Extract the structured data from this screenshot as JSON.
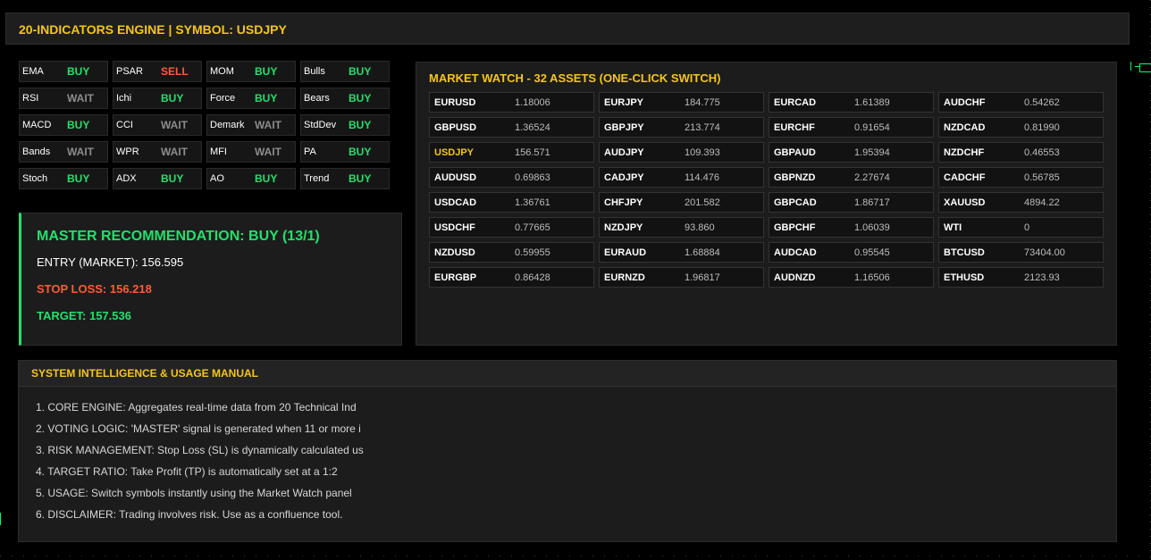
{
  "header": {
    "title": "20-INDICATORS ENGINE | SYMBOL: USDJPY"
  },
  "colors": {
    "buy": "#22e06b",
    "sell": "#ff5a36",
    "wait": "#8c8c8c",
    "accent": "#f5c518"
  },
  "indicators": [
    {
      "name": "EMA",
      "signal": "BUY"
    },
    {
      "name": "PSAR",
      "signal": "SELL"
    },
    {
      "name": "MOM",
      "signal": "BUY"
    },
    {
      "name": "Bulls",
      "signal": "BUY"
    },
    {
      "name": "RSI",
      "signal": "WAIT"
    },
    {
      "name": "Ichi",
      "signal": "BUY"
    },
    {
      "name": "Force",
      "signal": "BUY"
    },
    {
      "name": "Bears",
      "signal": "BUY"
    },
    {
      "name": "MACD",
      "signal": "BUY"
    },
    {
      "name": "CCI",
      "signal": "WAIT"
    },
    {
      "name": "Demark",
      "signal": "WAIT"
    },
    {
      "name": "StdDev",
      "signal": "BUY"
    },
    {
      "name": "Bands",
      "signal": "WAIT"
    },
    {
      "name": "WPR",
      "signal": "WAIT"
    },
    {
      "name": "MFI",
      "signal": "WAIT"
    },
    {
      "name": "PA",
      "signal": "BUY"
    },
    {
      "name": "Stoch",
      "signal": "BUY"
    },
    {
      "name": "ADX",
      "signal": "BUY"
    },
    {
      "name": "AO",
      "signal": "BUY"
    },
    {
      "name": "Trend",
      "signal": "BUY"
    }
  ],
  "master": {
    "title": "MASTER RECOMMENDATION: BUY (13/1)",
    "entry": "ENTRY (MARKET): 156.595",
    "stop_loss": "STOP LOSS: 156.218",
    "target": "TARGET: 157.536"
  },
  "market_watch": {
    "title": "MARKET WATCH - 32 ASSETS (ONE-CLICK SWITCH)",
    "active_symbol": "USDJPY",
    "columns": [
      [
        {
          "symbol": "EURUSD",
          "price": "1.18006"
        },
        {
          "symbol": "GBPUSD",
          "price": "1.36524"
        },
        {
          "symbol": "USDJPY",
          "price": "156.571"
        },
        {
          "symbol": "AUDUSD",
          "price": "0.69863"
        },
        {
          "symbol": "USDCAD",
          "price": "1.36761"
        },
        {
          "symbol": "USDCHF",
          "price": "0.77665"
        },
        {
          "symbol": "NZDUSD",
          "price": "0.59955"
        },
        {
          "symbol": "EURGBP",
          "price": "0.86428"
        }
      ],
      [
        {
          "symbol": "EURJPY",
          "price": "184.775"
        },
        {
          "symbol": "GBPJPY",
          "price": "213.774"
        },
        {
          "symbol": "AUDJPY",
          "price": "109.393"
        },
        {
          "symbol": "CADJPY",
          "price": "114.476"
        },
        {
          "symbol": "CHFJPY",
          "price": "201.582"
        },
        {
          "symbol": "NZDJPY",
          "price": "93.860"
        },
        {
          "symbol": "EURAUD",
          "price": "1.68884"
        },
        {
          "symbol": "EURNZD",
          "price": "1.96817"
        }
      ],
      [
        {
          "symbol": "EURCAD",
          "price": "1.61389"
        },
        {
          "symbol": "EURCHF",
          "price": "0.91654"
        },
        {
          "symbol": "GBPAUD",
          "price": "1.95394"
        },
        {
          "symbol": "GBPNZD",
          "price": "2.27674"
        },
        {
          "symbol": "GBPCAD",
          "price": "1.86717"
        },
        {
          "symbol": "GBPCHF",
          "price": "1.06039"
        },
        {
          "symbol": "AUDCAD",
          "price": "0.95545"
        },
        {
          "symbol": "AUDNZD",
          "price": "1.16506"
        }
      ],
      [
        {
          "symbol": "AUDCHF",
          "price": "0.54262"
        },
        {
          "symbol": "NZDCAD",
          "price": "0.81990"
        },
        {
          "symbol": "NZDCHF",
          "price": "0.46553"
        },
        {
          "symbol": "CADCHF",
          "price": "0.56785"
        },
        {
          "symbol": "XAUUSD",
          "price": "4894.22"
        },
        {
          "symbol": "WTI",
          "price": "0"
        },
        {
          "symbol": "BTCUSD",
          "price": "73404.00"
        },
        {
          "symbol": "ETHUSD",
          "price": "2123.93"
        }
      ]
    ]
  },
  "manual": {
    "title": "SYSTEM INTELLIGENCE & USAGE MANUAL",
    "lines": [
      "1. CORE ENGINE: Aggregates real-time data from 20 Technical Ind",
      "2. VOTING LOGIC: 'MASTER' signal is generated when 11 or more i",
      "3. RISK MANAGEMENT: Stop Loss (SL) is dynamically calculated us",
      "4. TARGET RATIO: Take Profit (TP) is automatically set at a 1:2",
      "5. USAGE: Switch symbols instantly using the Market Watch panel",
      "6. DISCLAIMER: Trading involves risk. Use as a confluence tool."
    ]
  }
}
